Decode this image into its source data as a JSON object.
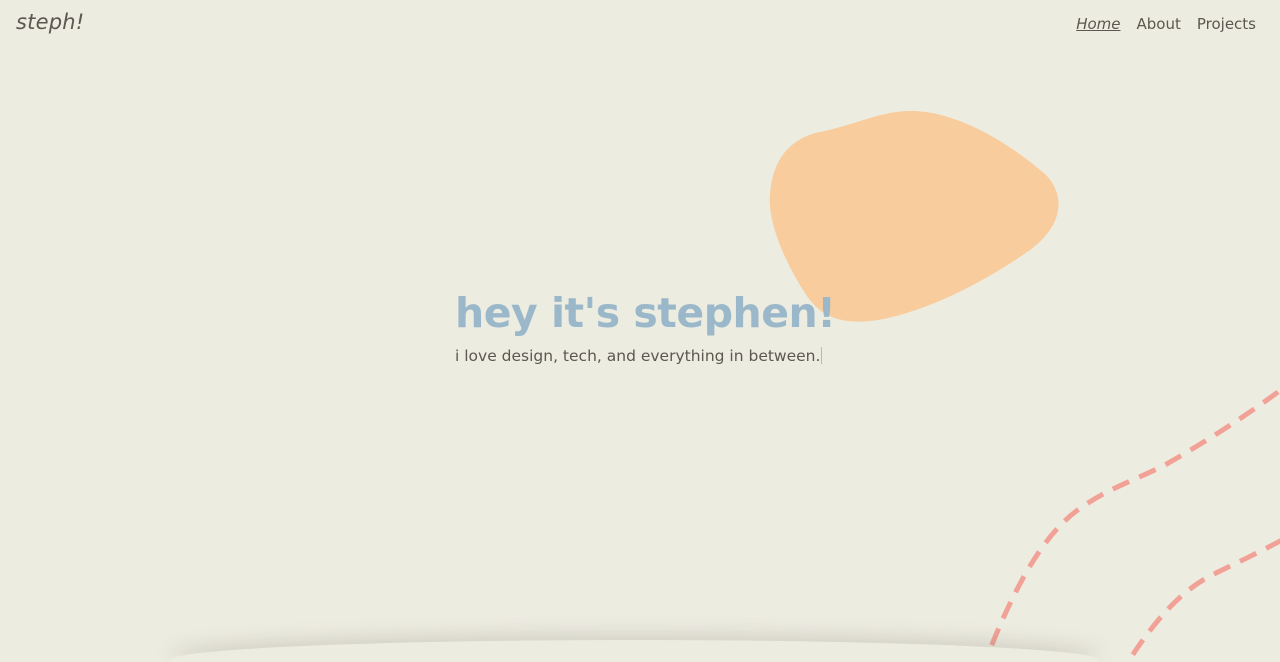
{
  "header": {
    "logo": "steph!",
    "nav": [
      {
        "label": "Home",
        "active": true
      },
      {
        "label": "About",
        "active": false
      },
      {
        "label": "Projects",
        "active": false
      }
    ]
  },
  "hero": {
    "title": "hey it's stephen!",
    "subtitle": "i love design, tech, and everything in between."
  },
  "colors": {
    "background": "#edece1",
    "title": "#9ab8c9",
    "text": "#5c574f",
    "blob": "#f8cc9c",
    "dash_line": "#f2a196"
  }
}
